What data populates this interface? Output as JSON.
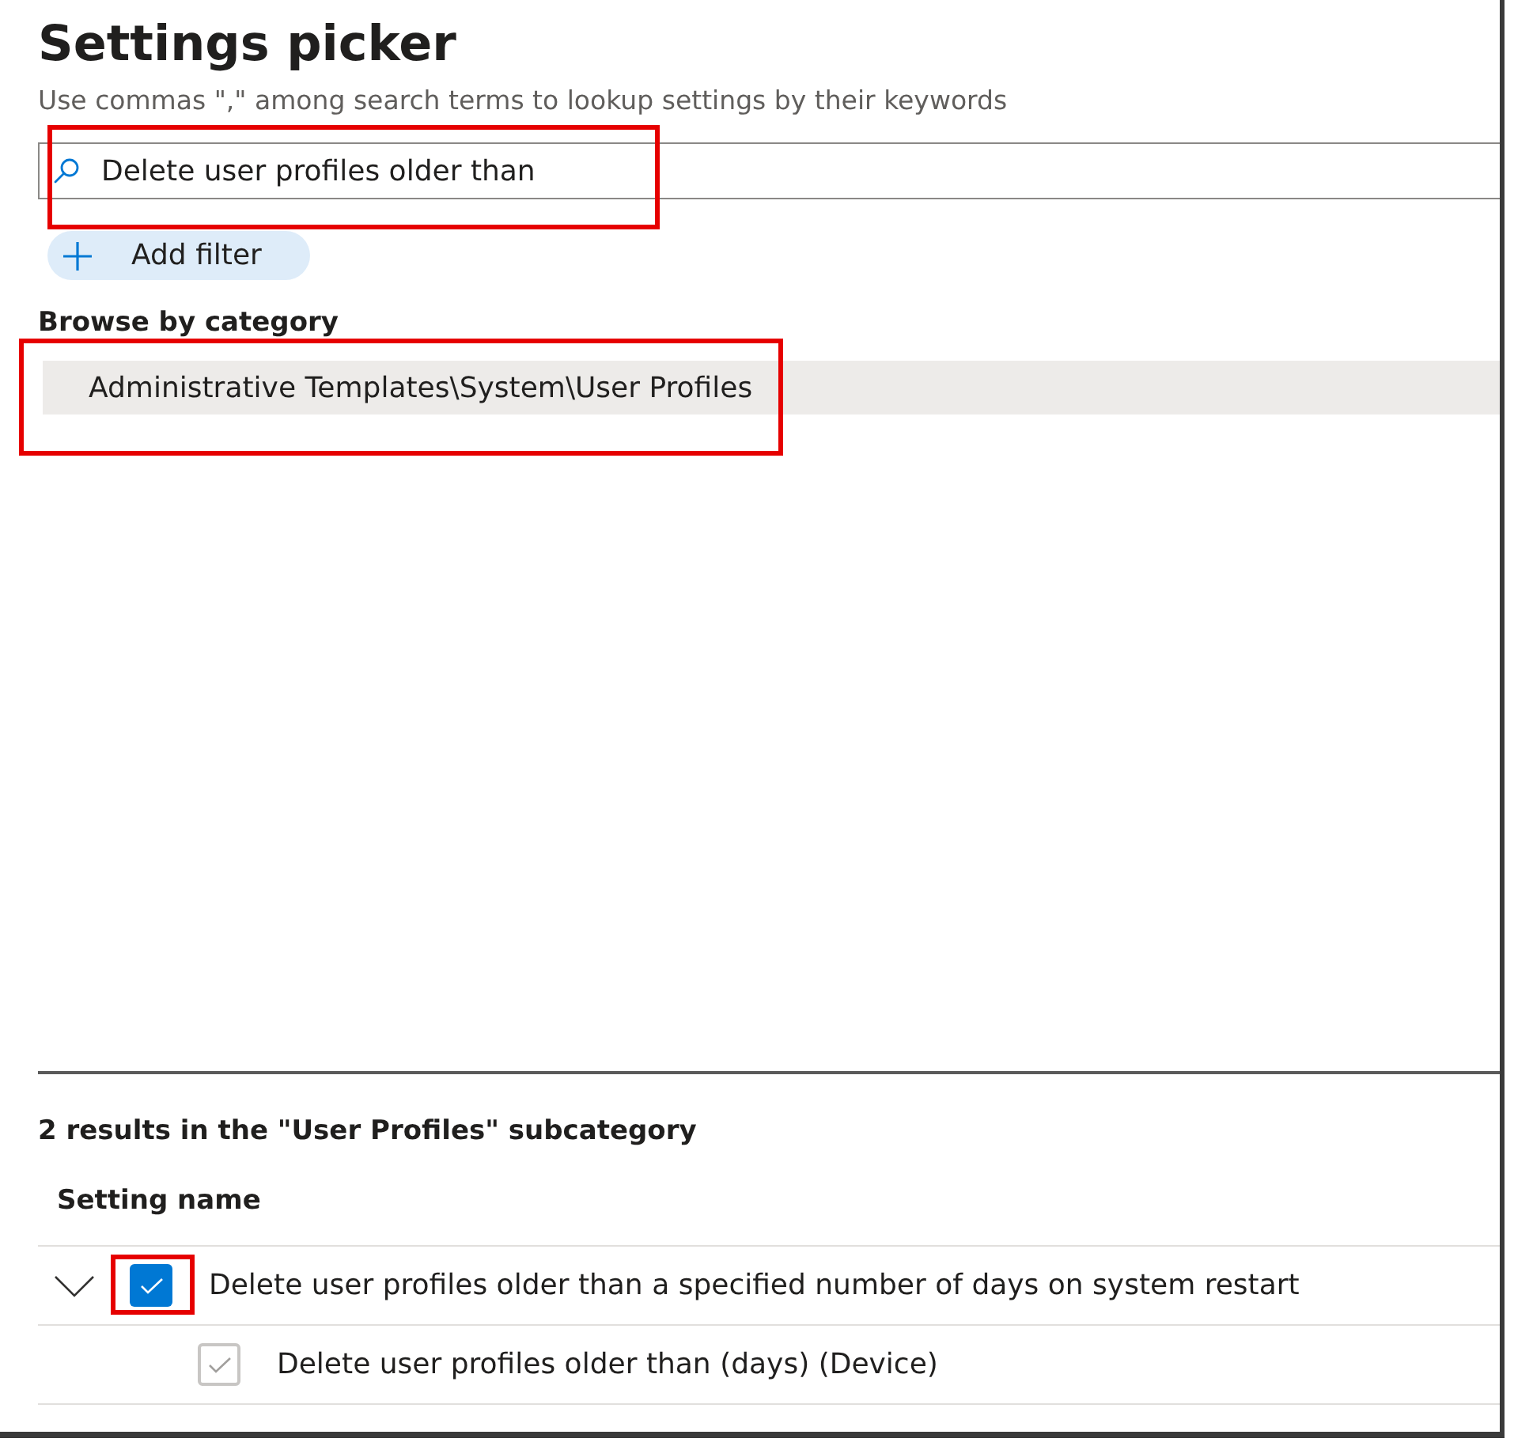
{
  "header": {
    "title": "Settings picker",
    "hint": "Use commas \",\" among search terms to lookup settings by their keywords"
  },
  "search": {
    "value": "Delete user profiles older than",
    "highlighted": true
  },
  "add_filter": {
    "label": "Add filter"
  },
  "browse": {
    "heading": "Browse by category",
    "categories": [
      {
        "label": "Administrative Templates\\System\\User Profiles",
        "selected": true,
        "highlighted": true
      }
    ]
  },
  "results": {
    "summary": "2 results in the \"User Profiles\" subcategory",
    "columns": [
      "Setting name"
    ],
    "rows": [
      {
        "label": "Delete user profiles older than a specified number of days on system restart",
        "checked": true,
        "disabled": false,
        "highlighted": true,
        "expanded": true,
        "children": [
          {
            "label": "Delete user profiles older than (days) (Device)",
            "checked": true,
            "disabled": true,
            "highlighted": false
          }
        ]
      }
    ]
  }
}
